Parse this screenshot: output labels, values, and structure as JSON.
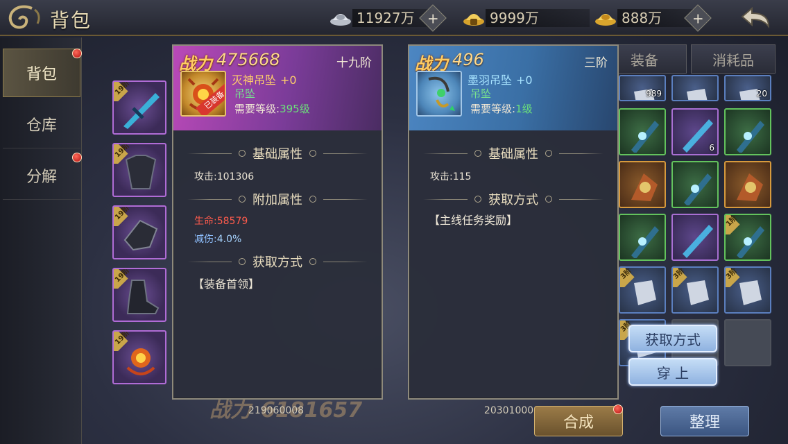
{
  "header": {
    "title": "背包",
    "currencies": [
      {
        "icon": "silver-ingot-icon",
        "value": "11927万",
        "has_add": true
      },
      {
        "icon": "gold-ingot-bound-icon",
        "value": "9999万",
        "has_add": false
      },
      {
        "icon": "gold-ingot-icon",
        "value": "888万",
        "has_add": true
      }
    ],
    "back_icon": "back-arrow-icon"
  },
  "nav": {
    "items": [
      {
        "label": "背包",
        "active": true,
        "red_dot": true
      },
      {
        "label": "仓库",
        "active": false,
        "red_dot": false
      },
      {
        "label": "分解",
        "active": false,
        "red_dot": true
      }
    ]
  },
  "equipped": [
    {
      "tier": "19阶",
      "kind": "weapon",
      "color": "purple"
    },
    {
      "tier": "19阶",
      "kind": "armor",
      "color": "purple"
    },
    {
      "tier": "19阶",
      "kind": "shoulder",
      "color": "purple"
    },
    {
      "tier": "19阶",
      "kind": "boot",
      "color": "purple"
    },
    {
      "tier": "19阶",
      "kind": "pendant",
      "color": "purple"
    }
  ],
  "tabs": {
    "equipment": "装备",
    "consumables": "消耗品"
  },
  "inventory": [
    {
      "color": "blue",
      "count": "989"
    },
    {
      "color": "blue",
      "count": ""
    },
    {
      "color": "blue",
      "count": "20"
    },
    {
      "color": "green",
      "count": ""
    },
    {
      "color": "purple",
      "count": "6"
    },
    {
      "color": "green",
      "count": ""
    },
    {
      "color": "orange",
      "count": ""
    },
    {
      "color": "green",
      "count": ""
    },
    {
      "color": "orange",
      "count": ""
    },
    {
      "color": "green",
      "count": ""
    },
    {
      "color": "purple",
      "count": ""
    },
    {
      "color": "green",
      "count": ""
    },
    {
      "color": "blue",
      "count": ""
    },
    {
      "color": "blue",
      "count": ""
    },
    {
      "color": "blue",
      "count": ""
    },
    {
      "color": "blue",
      "count": ""
    },
    {
      "color": "empty",
      "count": ""
    },
    {
      "color": "empty",
      "count": ""
    }
  ],
  "inventory_tiers": [
    "",
    "",
    "",
    "",
    "",
    "",
    "",
    "",
    "",
    "",
    "",
    "1阶",
    "3阶",
    "3阶",
    "3阶",
    "3阶",
    "",
    ""
  ],
  "panel_left": {
    "power_label": "战力",
    "power": "475668",
    "tier": "十九阶",
    "name": "灭神吊坠",
    "enhance": "+0",
    "type": "吊坠",
    "req_label": "需要等级:",
    "req_level": "395级",
    "equipped_badge": "已装备",
    "base_title": "基础属性",
    "base_attrs": [
      {
        "label": "攻击:",
        "value": "101306"
      }
    ],
    "extra_title": "附加属性",
    "extra_attrs": [
      {
        "label": "生命:",
        "value": "58579",
        "color": "#ff5b4c"
      },
      {
        "label": "减伤:",
        "value": "4.0%",
        "color": "#8fc0ff"
      }
    ],
    "source_title": "获取方式",
    "source": "【装备首领】",
    "id": "219060008"
  },
  "panel_right": {
    "power_label": "战力",
    "power": "496",
    "tier": "三阶",
    "name": "墨羽吊坠",
    "enhance": "+0",
    "type": "吊坠",
    "req_label": "需要等级:",
    "req_level": "1级",
    "base_title": "基础属性",
    "base_attrs": [
      {
        "label": "攻击:",
        "value": "115"
      }
    ],
    "source_title": "获取方式",
    "source": "【主线任务奖励】",
    "id": "203010008"
  },
  "background_power": {
    "label": "战力",
    "value": "6181657"
  },
  "buttons": {
    "get_method": "获取方式",
    "equip": "穿 上",
    "compose": "合成",
    "arrange": "整理"
  },
  "colors": {
    "accent_gold": "#ffcd63",
    "attr_red": "#ff5b4c",
    "attr_cyan": "#8fc0ff",
    "level_green": "#6ce27a"
  }
}
